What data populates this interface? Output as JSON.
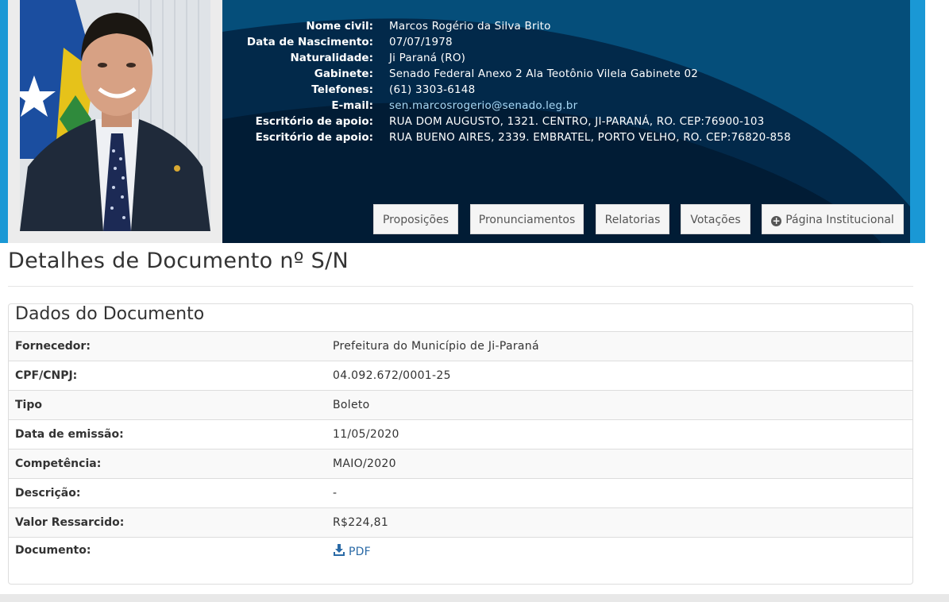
{
  "profile": {
    "rows": [
      {
        "label": "Nome civil:",
        "value": "Marcos Rogério da Silva Brito"
      },
      {
        "label": "Data de Nascimento:",
        "value": "07/07/1978"
      },
      {
        "label": "Naturalidade:",
        "value": "Ji Paraná (RO)"
      },
      {
        "label": "Gabinete:",
        "value": "Senado Federal Anexo 2 Ala Teotônio Vilela Gabinete 02"
      },
      {
        "label": "Telefones:",
        "value": "(61) 3303-6148"
      },
      {
        "label": "E-mail:",
        "value": "sen.marcosrogerio@senado.leg.br"
      },
      {
        "label": "Escritório de apoio:",
        "value": "RUA DOM AUGUSTO, 1321. CENTRO, JI-PARANÁ, RO. CEP:76900-103"
      },
      {
        "label": "Escritório de apoio:",
        "value": "RUA BUENO AIRES, 2339. EMBRATEL, PORTO VELHO, RO. CEP:76820-858"
      }
    ]
  },
  "nav": {
    "proposicoes": "Proposições",
    "pronunciamentos": "Pronunciamentos",
    "relatorias": "Relatorias",
    "votacoes": "Votações",
    "pagina_institucional": "Página Institucional"
  },
  "page": {
    "title": "Detalhes de Documento nº S/N"
  },
  "document": {
    "heading": "Dados do Documento",
    "rows": [
      {
        "label": "Fornecedor:",
        "value": "Prefeitura do Município de Ji-Paraná"
      },
      {
        "label": "CPF/CNPJ:",
        "value": "04.092.672/0001-25"
      },
      {
        "label": "Tipo",
        "value": "Boleto"
      },
      {
        "label": "Data de emissão:",
        "value": "11/05/2020"
      },
      {
        "label": "Competência:",
        "value": "MAIO/2020"
      },
      {
        "label": "Descrição:",
        "value": "-"
      },
      {
        "label": "Valor Ressarcido:",
        "value": "R$224,81"
      },
      {
        "label": "Documento:",
        "value": "PDF"
      }
    ]
  },
  "icons": {
    "plus_circle": "plus-circle-icon",
    "download": "download-icon"
  },
  "colors": {
    "header_dark": "#02294a",
    "header_accent": "#1a98d5",
    "link": "#2a6aa6"
  }
}
